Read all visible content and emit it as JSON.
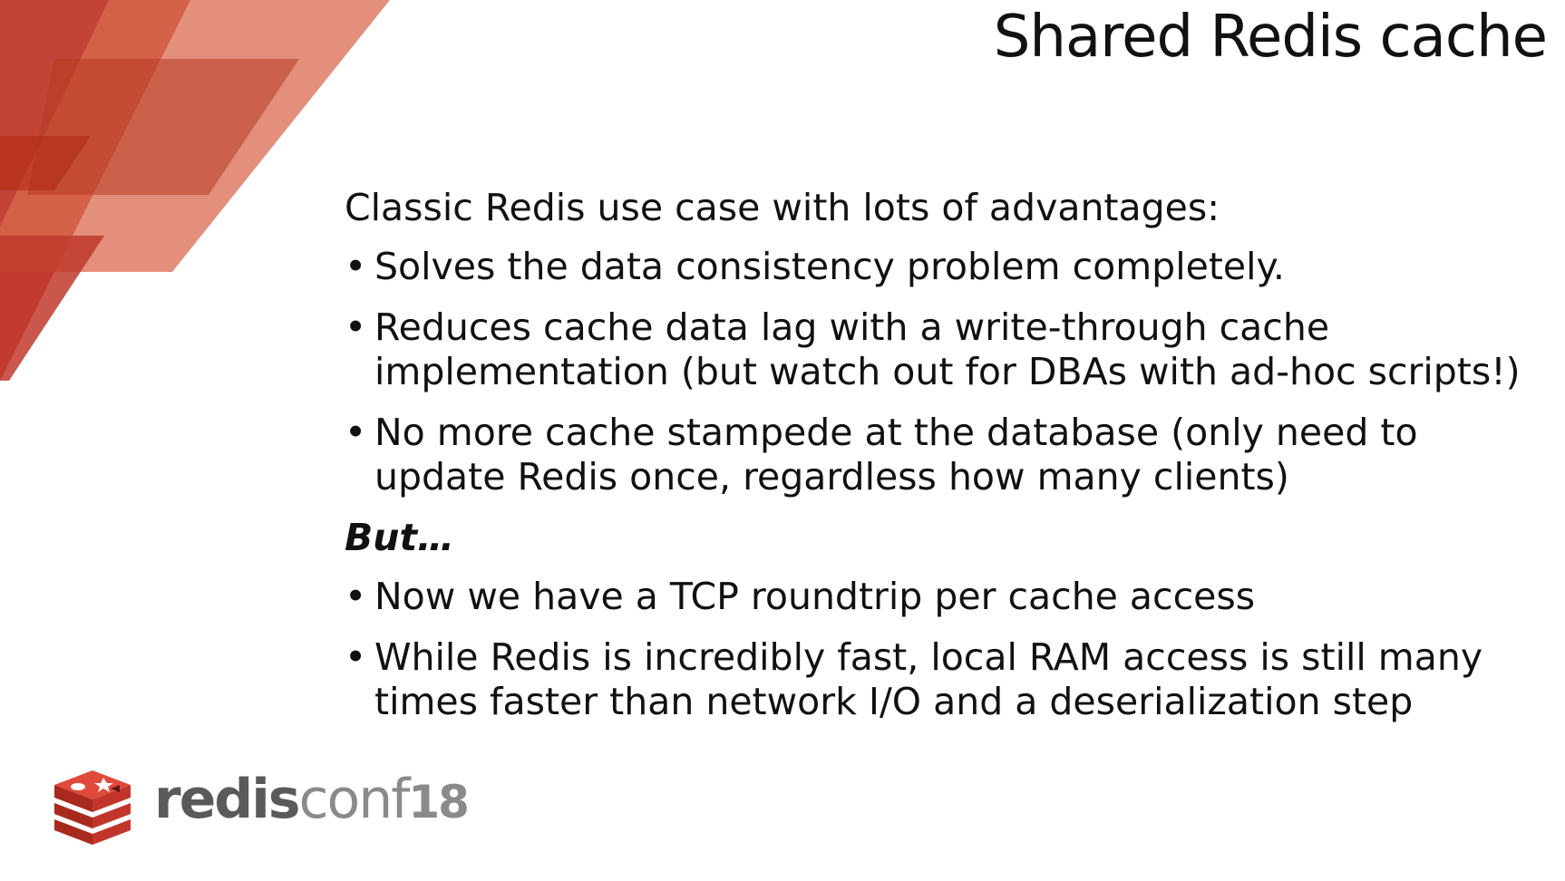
{
  "slide": {
    "title": "Shared Redis cache",
    "intro": "Classic Redis use case with lots of advantages:",
    "advantages": [
      "Solves the data consistency problem completely.",
      "Reduces cache data lag with a write-through cache implementation (but watch out for DBAs with ad-hoc scripts!)",
      "No more cache stampede at the database (only need to update Redis once, regardless how many clients)"
    ],
    "but_heading": "But…",
    "drawbacks": [
      "Now we have a TCP roundtrip per cache access",
      "While Redis is incredibly fast, local RAM access is still many times faster than network I/O and a deserialization step"
    ],
    "bullet_glyph": "•"
  },
  "logo": {
    "part_bold": "redis",
    "part_light": "conf",
    "part_number": "18",
    "icon": "redis-cube-icon"
  },
  "colors": {
    "accent_dark": "#c0392b",
    "accent_mid": "#d05a3c",
    "accent_light": "#e08a70",
    "text": "#111111"
  }
}
